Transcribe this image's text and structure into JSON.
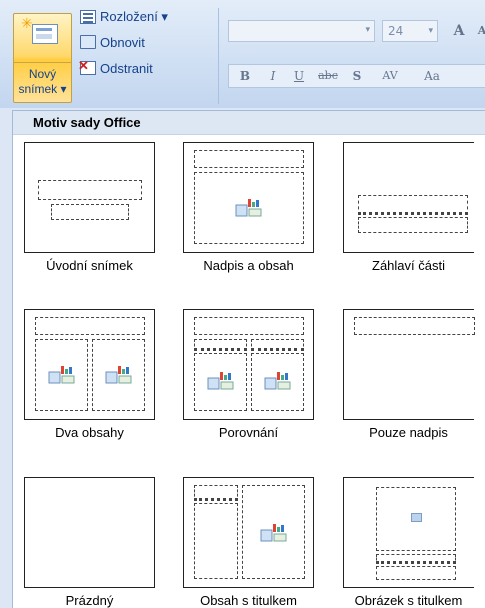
{
  "ribbon": {
    "new_slide": {
      "line1": "Nový",
      "line2": "snímek ▾"
    },
    "layout_label": "Rozložení ▾",
    "reset_label": "Obnovit",
    "delete_label": "Odstranit",
    "font_name": "",
    "font_size": "24",
    "grow_font": "A",
    "shrink_font": "A",
    "format_buttons": [
      "B",
      "I",
      "U",
      "abc",
      "S",
      "AV",
      "Aa"
    ]
  },
  "gallery": {
    "header": "Motiv sady Office",
    "layouts": [
      {
        "caption": "Úvodní snímek",
        "type": "title"
      },
      {
        "caption": "Nadpis a obsah",
        "type": "title-content"
      },
      {
        "caption": "Záhlaví části",
        "type": "section-header"
      },
      {
        "caption": "Dva obsahy",
        "type": "two-content"
      },
      {
        "caption": "Porovnání",
        "type": "comparison"
      },
      {
        "caption": "Pouze nadpis",
        "type": "title-only"
      },
      {
        "caption": "Prázdný",
        "type": "blank"
      },
      {
        "caption": "Obsah s titulkem",
        "type": "content-caption"
      },
      {
        "caption": "Obrázek s titulkem",
        "type": "picture-caption"
      }
    ]
  }
}
